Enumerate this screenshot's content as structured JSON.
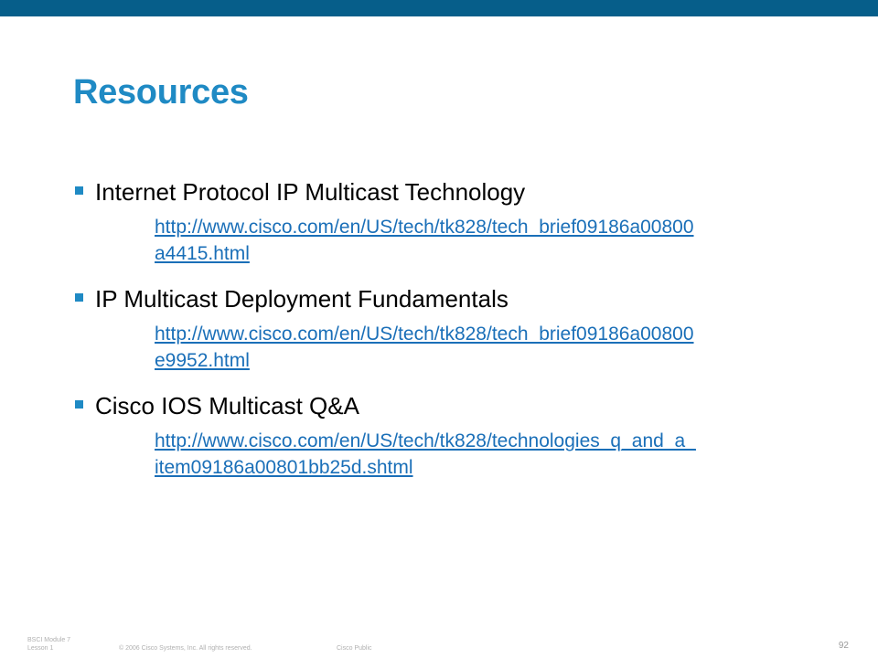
{
  "title": "Resources",
  "bullets": [
    {
      "text": "Internet Protocol IP Multicast Technology",
      "link_line1": "http://www.cisco.com/en/US/tech/tk828/tech_brief09186a00800",
      "link_line2": "a4415.html"
    },
    {
      "text": "IP Multicast Deployment Fundamentals",
      "link_line1": "http://www.cisco.com/en/US/tech/tk828/tech_brief09186a00800",
      "link_line2": "e9952.html"
    },
    {
      "text": "Cisco IOS Multicast Q&A",
      "link_line1": "http://www.cisco.com/en/US/tech/tk828/technologies_q_and_a_",
      "link_line2": "item09186a00801bb25d.shtml"
    }
  ],
  "footer": {
    "course_line1": "BSCI Module 7",
    "course_line2": "Lesson 1",
    "copyright": "© 2006 Cisco Systems, Inc. All rights reserved.",
    "classification": "Cisco Public",
    "page_number": "92"
  },
  "colors": {
    "top_bar": "#065e8a",
    "title": "#1f8ac4",
    "bullet_marker": "#1f8ac4",
    "link": "#1a6fb8"
  }
}
